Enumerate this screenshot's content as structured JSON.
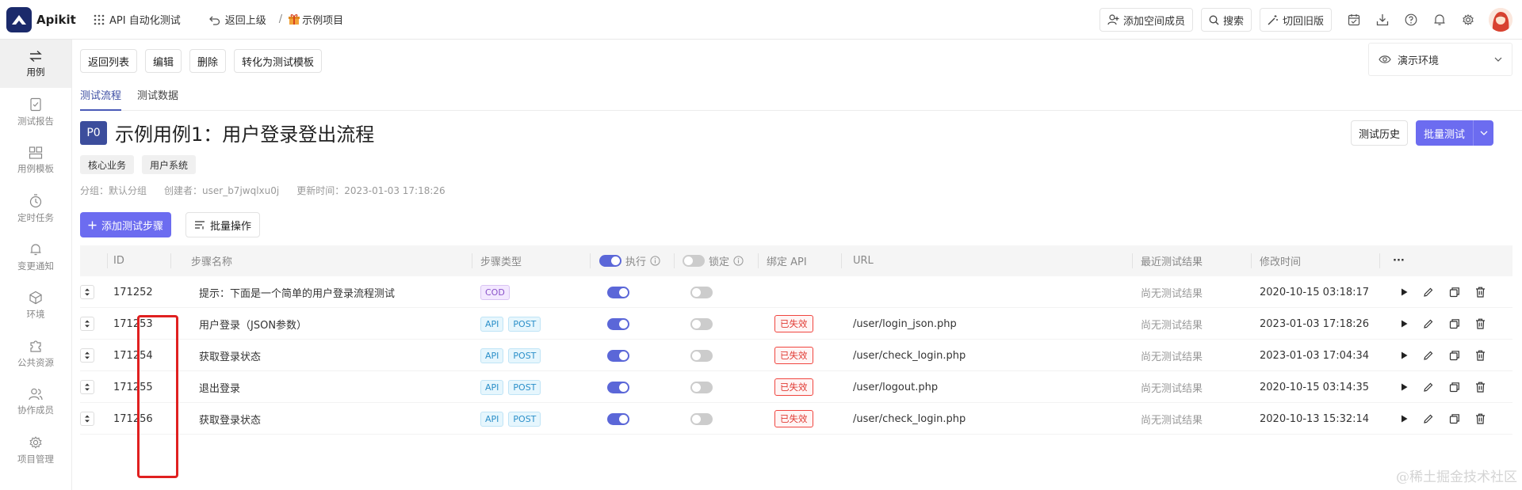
{
  "topbar": {
    "brand": "Apikit",
    "workspace": "API 自动化测试",
    "back_up": "返回上级",
    "separator": "/",
    "project": "示例项目",
    "add_member": "添加空间成员",
    "search": "搜索",
    "switch_old": "切回旧版"
  },
  "sidebar": {
    "items": [
      {
        "label": "用例",
        "icon": "swap-icon"
      },
      {
        "label": "测试报告",
        "icon": "report-icon"
      },
      {
        "label": "用例模板",
        "icon": "template-icon"
      },
      {
        "label": "定时任务",
        "icon": "timer-icon"
      },
      {
        "label": "变更通知",
        "icon": "bell-icon"
      },
      {
        "label": "环境",
        "icon": "cube-icon"
      },
      {
        "label": "公共资源",
        "icon": "puzzle-icon"
      },
      {
        "label": "协作成员",
        "icon": "users-icon"
      },
      {
        "label": "项目管理",
        "icon": "gear-icon"
      }
    ]
  },
  "toolbar": {
    "back_list": "返回列表",
    "edit": "编辑",
    "delete": "删除",
    "to_template": "转化为测试模板"
  },
  "environment": "演示环境",
  "tabs": [
    "测试流程",
    "测试数据"
  ],
  "case": {
    "priority": "P0",
    "title": "示例用例1：用户登录登出流程",
    "history_btn": "测试历史",
    "batch_test_btn": "批量测试",
    "tags": [
      "核心业务",
      "用户系统"
    ],
    "group": "分组：默认分组",
    "creator": "创建者：user_b7jwqlxu0j",
    "updated": "更新时间：2023-01-03 17:18:26"
  },
  "actions": {
    "add_step": "添加测试步骤",
    "batch_op": "批量操作"
  },
  "table": {
    "headers": {
      "id": "ID",
      "name": "步骤名称",
      "type": "步骤类型",
      "exec": "执行",
      "lock": "锁定",
      "bind_api": "绑定 API",
      "url": "URL",
      "result": "最近测试结果",
      "modified": "修改时间",
      "more": "···"
    },
    "rows": [
      {
        "id": "171252",
        "name": "提示：下面是一个简单的用户登录流程测试",
        "types": [
          "COD"
        ],
        "exec": true,
        "lock": false,
        "bind": "",
        "url": "",
        "result": "尚无测试结果",
        "modified": "2020-10-15 03:18:17"
      },
      {
        "id": "171253",
        "name": "用户登录（JSON参数）",
        "types": [
          "API",
          "POST"
        ],
        "exec": true,
        "lock": false,
        "bind": "已失效",
        "url": "/user/login_json.php",
        "result": "尚无测试结果",
        "modified": "2023-01-03 17:18:26"
      },
      {
        "id": "171254",
        "name": "获取登录状态",
        "types": [
          "API",
          "POST"
        ],
        "exec": true,
        "lock": false,
        "bind": "已失效",
        "url": "/user/check_login.php",
        "result": "尚无测试结果",
        "modified": "2023-01-03 17:04:34"
      },
      {
        "id": "171255",
        "name": "退出登录",
        "types": [
          "API",
          "POST"
        ],
        "exec": true,
        "lock": false,
        "bind": "已失效",
        "url": "/user/logout.php",
        "result": "尚无测试结果",
        "modified": "2020-10-15 03:14:35"
      },
      {
        "id": "171256",
        "name": "获取登录状态",
        "types": [
          "API",
          "POST"
        ],
        "exec": true,
        "lock": false,
        "bind": "已失效",
        "url": "/user/check_login.php",
        "result": "尚无测试结果",
        "modified": "2020-10-13 15:32:14"
      }
    ]
  },
  "watermark": "@稀土掘金技术社区",
  "colors": {
    "primary": "#6c6cf0",
    "brand": "#1b2a6b",
    "expired": "#e03a33",
    "highlight": "#e02020"
  }
}
